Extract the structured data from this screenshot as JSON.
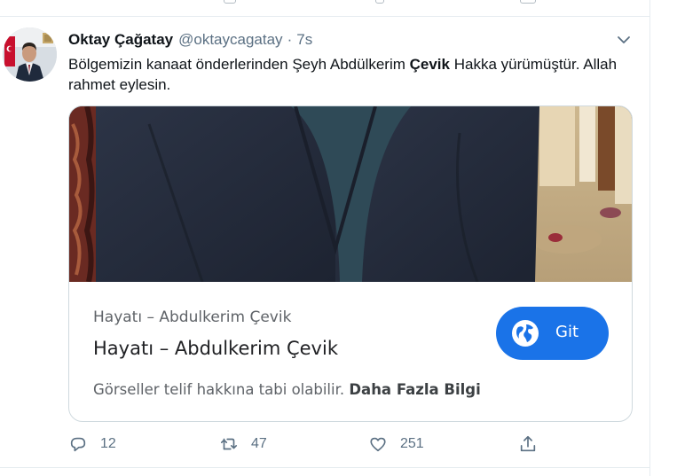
{
  "tweet": {
    "name": "Oktay Çağatay",
    "handle": "@oktaycagatay",
    "separator": "·",
    "time": "7s",
    "text_before": "Bölgemizin kanaat önderlerinden Şeyh Abdülkerim ",
    "text_bold": "Çevik",
    "text_after": " Hakka yürümüştür. Allah rahmet eylesin."
  },
  "card": {
    "site": "Hayatı – Abdulkerim Çevik",
    "title": "Hayatı – Abdulkerim Çevik",
    "note_text": "Görseller telif hakkına tabi olabilir.",
    "note_link": "Daha Fazla Bilgi",
    "button_label": "Git",
    "button_color": "#1a73e8"
  },
  "actions": {
    "reply_count": "12",
    "retweet_count": "47",
    "like_count": "251"
  },
  "icons": {
    "more": "chevron-down-icon",
    "reply": "reply-icon",
    "retweet": "retweet-icon",
    "like": "heart-icon",
    "share": "share-icon",
    "button": "globe-icon"
  },
  "colors": {
    "secondary_text": "#5b7083",
    "divider": "#e6ecf0"
  }
}
